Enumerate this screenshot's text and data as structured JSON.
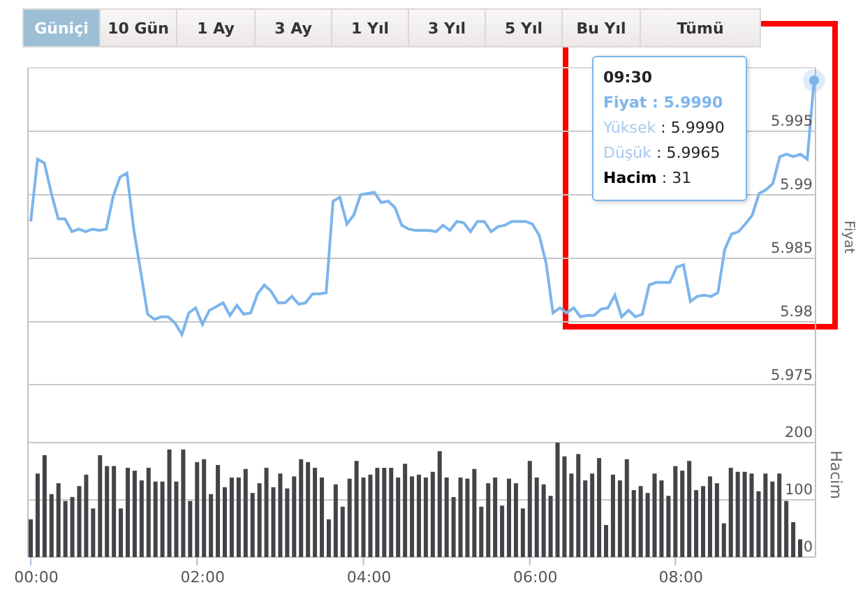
{
  "tabs": [
    {
      "label": "Güniçi",
      "selected": true
    },
    {
      "label": "10 Gün",
      "selected": false
    },
    {
      "label": "1 Ay",
      "selected": false
    },
    {
      "label": "3 Ay",
      "selected": false
    },
    {
      "label": "1 Yıl",
      "selected": false
    },
    {
      "label": "3 Yıl",
      "selected": false
    },
    {
      "label": "5 Yıl",
      "selected": false
    },
    {
      "label": "Bu Yıl",
      "selected": false
    },
    {
      "label": "Tümü",
      "selected": false
    }
  ],
  "price_chart": {
    "chart_data": {
      "type": "line",
      "ylabel": "Fiyat",
      "grid": true,
      "ylim": [
        5.975,
        6.0
      ],
      "yticks": [
        5.975,
        5.98,
        5.985,
        5.99,
        5.995
      ],
      "series": [
        {
          "color": "#7cb5ec",
          "values": [
            5.9879,
            5.9928,
            5.9925,
            5.9901,
            5.9881,
            5.9881,
            5.9871,
            5.9873,
            5.9871,
            5.9873,
            5.9872,
            5.9873,
            5.9899,
            5.9914,
            5.9917,
            5.9873,
            5.984,
            5.9806,
            5.9802,
            5.9804,
            5.9804,
            5.9799,
            5.979,
            5.9807,
            5.9811,
            5.9798,
            5.9809,
            5.9812,
            5.9815,
            5.9805,
            5.9813,
            5.9806,
            5.9807,
            5.9822,
            5.9829,
            5.9824,
            5.9815,
            5.9815,
            5.982,
            5.9814,
            5.9815,
            5.9822,
            5.9822,
            5.9823,
            5.9895,
            5.9898,
            5.9877,
            5.9884,
            5.99,
            5.9901,
            5.9902,
            5.9894,
            5.9895,
            5.989,
            5.9876,
            5.9873,
            5.9872,
            5.9872,
            5.9872,
            5.9871,
            5.9876,
            5.9872,
            5.9879,
            5.9878,
            5.9871,
            5.9879,
            5.9879,
            5.9871,
            5.9875,
            5.9876,
            5.9879,
            5.9879,
            5.9879,
            5.9877,
            5.9868,
            5.9846,
            5.9807,
            5.9811,
            5.9807,
            5.9811,
            5.9804,
            5.9805,
            5.9805,
            5.981,
            5.9811,
            5.9821,
            5.9804,
            5.9809,
            5.9804,
            5.9806,
            5.9829,
            5.9831,
            5.9831,
            5.9831,
            5.9843,
            5.9845,
            5.9816,
            5.982,
            5.9821,
            5.982,
            5.9823,
            5.9857,
            5.9869,
            5.9871,
            5.9877,
            5.9884,
            5.9901,
            5.9904,
            5.9909,
            5.993,
            5.9932,
            5.993,
            5.9932,
            5.9928,
            5.999
          ]
        }
      ]
    },
    "tooltip": {
      "title": "09:30",
      "separator": ":",
      "rows": [
        {
          "kind": "series",
          "label": "Fiyat",
          "value": "5.9990"
        },
        {
          "kind": "range",
          "label": "Yüksek",
          "value": "5.9990"
        },
        {
          "kind": "range",
          "label": "Düşük",
          "value": "5.9965"
        },
        {
          "kind": "volume",
          "label": "Hacim",
          "value": "31"
        }
      ]
    }
  },
  "volume_chart": {
    "chart_data": {
      "type": "bar",
      "ylabel": "Hacim",
      "grid": true,
      "ylim": [
        0,
        300
      ],
      "yticks": [
        0,
        100,
        200
      ],
      "series": [
        {
          "color": "#434348",
          "values": [
            66,
            146,
            178,
            110,
            129,
            98,
            105,
            124,
            144,
            85,
            178,
            159,
            159,
            85,
            156,
            151,
            134,
            156,
            132,
            132,
            188,
            132,
            188,
            98,
            166,
            171,
            110,
            161,
            122,
            139,
            139,
            154,
            112,
            129,
            156,
            122,
            146,
            120,
            141,
            171,
            166,
            156,
            139,
            66,
            127,
            88,
            137,
            168,
            139,
            144,
            156,
            156,
            156,
            139,
            163,
            141,
            144,
            139,
            149,
            185,
            139,
            105,
            139,
            137,
            154,
            88,
            129,
            139,
            90,
            137,
            129,
            85,
            168,
            139,
            127,
            107,
            200,
            176,
            146,
            180,
            134,
            146,
            173,
            56,
            144,
            134,
            171,
            117,
            124,
            112,
            146,
            134,
            107,
            159,
            151,
            168,
            117,
            124,
            141,
            129,
            59,
            156,
            149,
            149,
            146,
            115,
            146,
            132,
            146,
            98,
            61,
            31
          ]
        }
      ]
    },
    "time_labels": [
      "00:00",
      "02:00",
      "04:00",
      "06:00",
      "08:00"
    ]
  },
  "highlight": {
    "color": "#ff0000"
  }
}
